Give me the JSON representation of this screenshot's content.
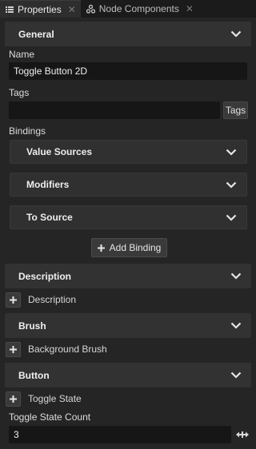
{
  "tabs": [
    {
      "label": "Properties",
      "icon": "list-icon",
      "active": true
    },
    {
      "label": "Node Components",
      "icon": "components-icon",
      "active": false
    }
  ],
  "general": {
    "title": "General",
    "name_label": "Name",
    "name_value": "Toggle Button 2D",
    "tags_label": "Tags",
    "tags_value": "",
    "tags_button": "Tags",
    "bindings_label": "Bindings",
    "bindings": [
      {
        "title": "Value Sources"
      },
      {
        "title": "Modifiers"
      },
      {
        "title": "To Source"
      }
    ],
    "add_binding": "Add Binding"
  },
  "description": {
    "title": "Description",
    "add_label": "Description"
  },
  "brush": {
    "title": "Brush",
    "add_label": "Background Brush"
  },
  "button": {
    "title": "Button",
    "add_label": "Toggle State",
    "count_label": "Toggle State Count",
    "count_value": "3"
  },
  "colors": {
    "background": "#252525",
    "header": "#323232",
    "input": "#161616"
  }
}
